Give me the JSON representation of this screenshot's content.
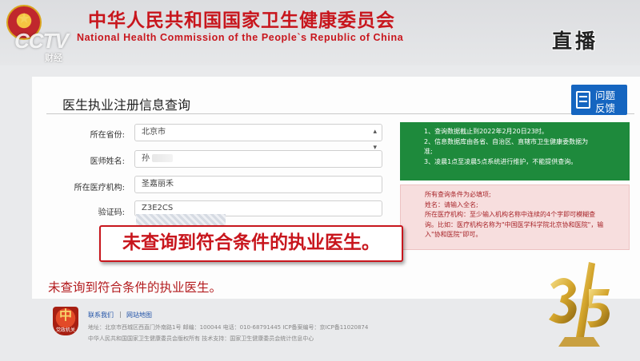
{
  "header": {
    "org_name_cn": "中华人民共和国国家卫生健康委员会",
    "org_name_en": "National Health Commission of the People`s Republic of China"
  },
  "broadcast": {
    "channel_logo": "CCTV",
    "channel_sub": "财经",
    "live_label": "直播"
  },
  "page": {
    "title": "医生执业注册信息查询",
    "feedback_line1": "问题",
    "feedback_line2": "反馈"
  },
  "form": {
    "province_label": "所在省份:",
    "province_value": "北京市",
    "name_label": "医师姓名:",
    "name_value": "孙",
    "institution_label": "所在医疗机构:",
    "institution_value": "圣嘉丽禾",
    "captcha_label": "验证码:",
    "captcha_value": "Z3E2CS"
  },
  "notice_green": {
    "line1": "1、查询数据截止到2022年2月20日23时。",
    "line2": "2、信息数据库由各省、自治区、直辖市卫生健康委数据为",
    "line3": "准;",
    "line4": "3、凌晨1点至凌晨5点系统进行维护，不能提供查询。"
  },
  "notice_pink": {
    "line1": "所有查询条件为必填项;",
    "line2": "姓名：请输入全名;",
    "line3": "所在医疗机构：至少输入机构名称中连续的4个字即可模糊查",
    "line4": "询。比如：医疗机构名称为\"中国医学科学院北京协和医院\"，输",
    "line5": "入\"协和医院\"即可。"
  },
  "subtitle": "未查询到符合条件的执业医生。",
  "result": "未查询到符合条件的执业医生。",
  "footer": {
    "badge_text": "党政机关",
    "contact_link": "联系我们",
    "sitemap_link": "网站地图",
    "separator": "|",
    "address_line": "地址：北京市西城区西直门外南路1号   邮编：100044   电话：010-68791445   ICP备案编号：京ICP备11020874",
    "copyright_line": "中华人民共和国国家卫生健康委员会版权所有    技术支持：国家卫生健康委员会统计信息中心"
  },
  "colors": {
    "brand_red": "#c8161d",
    "notice_green": "#1e8a3c",
    "notice_pink_bg": "#f7dede",
    "feedback_blue": "#1565c0",
    "link_blue": "#2354a8"
  },
  "icons": {
    "emblem": "national-emblem-icon",
    "feedback": "feedback-icon",
    "select": "chevron-updown-icon",
    "badge": "government-badge-icon",
    "trophy": "315-trophy-icon"
  }
}
